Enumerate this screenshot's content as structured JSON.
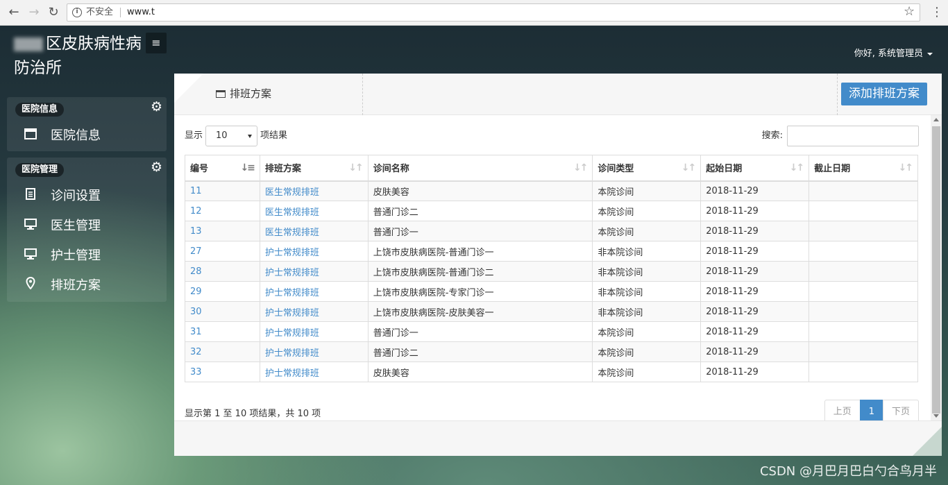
{
  "browser": {
    "security_label": "不安全",
    "url": "www.t"
  },
  "sidebar": {
    "brand_line1": "区皮肤病性病",
    "brand_line2": "防治所",
    "toggle_icon": "≡",
    "groups": [
      {
        "title": "医院信息",
        "items": [
          {
            "label": "医院信息",
            "icon": "window-icon"
          }
        ]
      },
      {
        "title": "医院管理",
        "items": [
          {
            "label": "诊间设置",
            "icon": "document-icon"
          },
          {
            "label": "医生管理",
            "icon": "monitor-icon"
          },
          {
            "label": "护士管理",
            "icon": "monitor-icon"
          },
          {
            "label": "排班方案",
            "icon": "map-pin-icon"
          }
        ]
      }
    ]
  },
  "header": {
    "user_greeting": "你好, 系统管理员"
  },
  "page": {
    "title": "排班方案",
    "add_button": "添加排班方案",
    "length_prefix": "显示",
    "length_value": "10",
    "length_suffix": "项结果",
    "search_label": "搜索:",
    "info": "显示第 1 至 10 项结果，共 10 项",
    "pager": {
      "prev": "上页",
      "current": "1",
      "next": "下页"
    }
  },
  "table": {
    "columns": [
      "编号",
      "排班方案",
      "诊间名称",
      "诊间类型",
      "起始日期",
      "截止日期"
    ],
    "rows": [
      [
        "11",
        "医生常规排班",
        "皮肤美容",
        "本院诊间",
        "2018-11-29",
        ""
      ],
      [
        "12",
        "医生常规排班",
        "普通门诊二",
        "本院诊间",
        "2018-11-29",
        ""
      ],
      [
        "13",
        "医生常规排班",
        "普通门诊一",
        "本院诊间",
        "2018-11-29",
        ""
      ],
      [
        "27",
        "护士常规排班",
        "上饶市皮肤病医院-普通门诊一",
        "非本院诊间",
        "2018-11-29",
        ""
      ],
      [
        "28",
        "护士常规排班",
        "上饶市皮肤病医院-普通门诊二",
        "非本院诊间",
        "2018-11-29",
        ""
      ],
      [
        "29",
        "护士常规排班",
        "上饶市皮肤病医院-专家门诊一",
        "非本院诊间",
        "2018-11-29",
        ""
      ],
      [
        "30",
        "护士常规排班",
        "上饶市皮肤病医院-皮肤美容一",
        "非本院诊间",
        "2018-11-29",
        ""
      ],
      [
        "31",
        "护士常规排班",
        "普通门诊一",
        "本院诊间",
        "2018-11-29",
        ""
      ],
      [
        "32",
        "护士常规排班",
        "普通门诊二",
        "本院诊间",
        "2018-11-29",
        ""
      ],
      [
        "33",
        "护士常规排班",
        "皮肤美容",
        "本院诊间",
        "2018-11-29",
        ""
      ]
    ]
  },
  "watermark": "CSDN @月巴月巴白勺合鸟月半",
  "colors": {
    "accent": "#428bca",
    "link": "#428bca"
  }
}
